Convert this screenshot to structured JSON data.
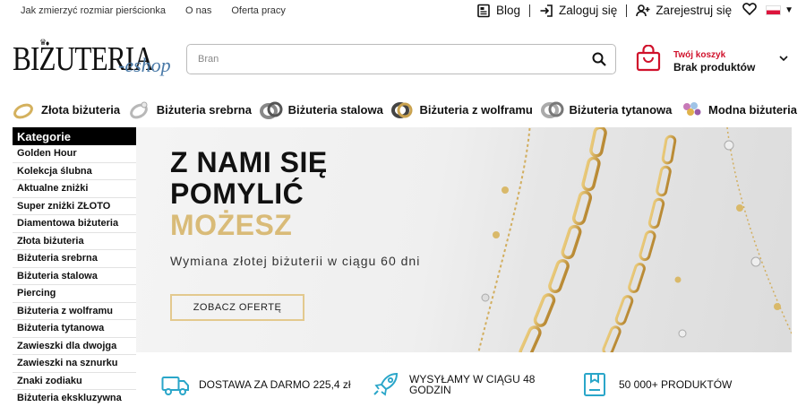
{
  "topbar": {
    "links": [
      "Jak zmierzyć rozmiar pierścionka",
      "O nas",
      "Oferta pracy"
    ],
    "blog": "Blog",
    "login": "Zaloguj się",
    "register": "Zarejestruj się"
  },
  "header": {
    "logo_main": "BIŻUTERIA",
    "logo_sub": "-eshop",
    "search_placeholder": "Bran",
    "cart_title": "Twój koszyk",
    "cart_status": "Brak produktów"
  },
  "category_nav": [
    {
      "label": "Złota biżuteria",
      "icon": "gold-ring-icon"
    },
    {
      "label": "Biżuteria srebrna",
      "icon": "silver-ring-icon"
    },
    {
      "label": "Biżuteria stalowa",
      "icon": "steel-ring-icon"
    },
    {
      "label": "Biżuteria z wolframu",
      "icon": "tungsten-ring-icon"
    },
    {
      "label": "Biżuteria tytanowa",
      "icon": "titanium-ring-icon"
    },
    {
      "label": "Modna biżuteria",
      "icon": "fashion-jewelry-icon"
    }
  ],
  "sidebar": {
    "heading": "Kategorie",
    "items": [
      "Golden Hour",
      "Kolekcja ślubna",
      "Aktualne zniżki",
      "Super zniżki ZŁOTO",
      "Diamentowa biżuteria",
      "Złota biżuteria",
      "Biżuteria srebrna",
      "Biżuteria stalowa",
      "Piercing",
      "Biżuteria z wolframu",
      "Biżuteria tytanowa",
      "Zawieszki dla dwojga",
      "Zawieszki na sznurku",
      "Znaki zodiaku",
      "Biżuteria ekskluzywna"
    ]
  },
  "hero": {
    "line1": "Z NAMI SIĘ",
    "line2": "POMYLIĆ",
    "line3": "MOŻESZ",
    "subtitle": "Wymiana złotej biżuterii w ciągu 60 dni",
    "cta": "ZOBACZ OFERTĘ"
  },
  "features": [
    {
      "label": "DOSTAWA ZA DARMO 225,4 zł",
      "icon": "delivery-truck-icon"
    },
    {
      "label": "WYSYŁAMY W CIĄGU 48 GODZIN",
      "icon": "rocket-icon"
    },
    {
      "label": "50 000+ PRODUKTÓW",
      "icon": "product-box-icon"
    }
  ],
  "colors": {
    "accent_gold": "#d9bb78",
    "cart_red": "#d0112b",
    "feature_teal": "#2aa6c9",
    "flag_red": "#dc143c"
  }
}
